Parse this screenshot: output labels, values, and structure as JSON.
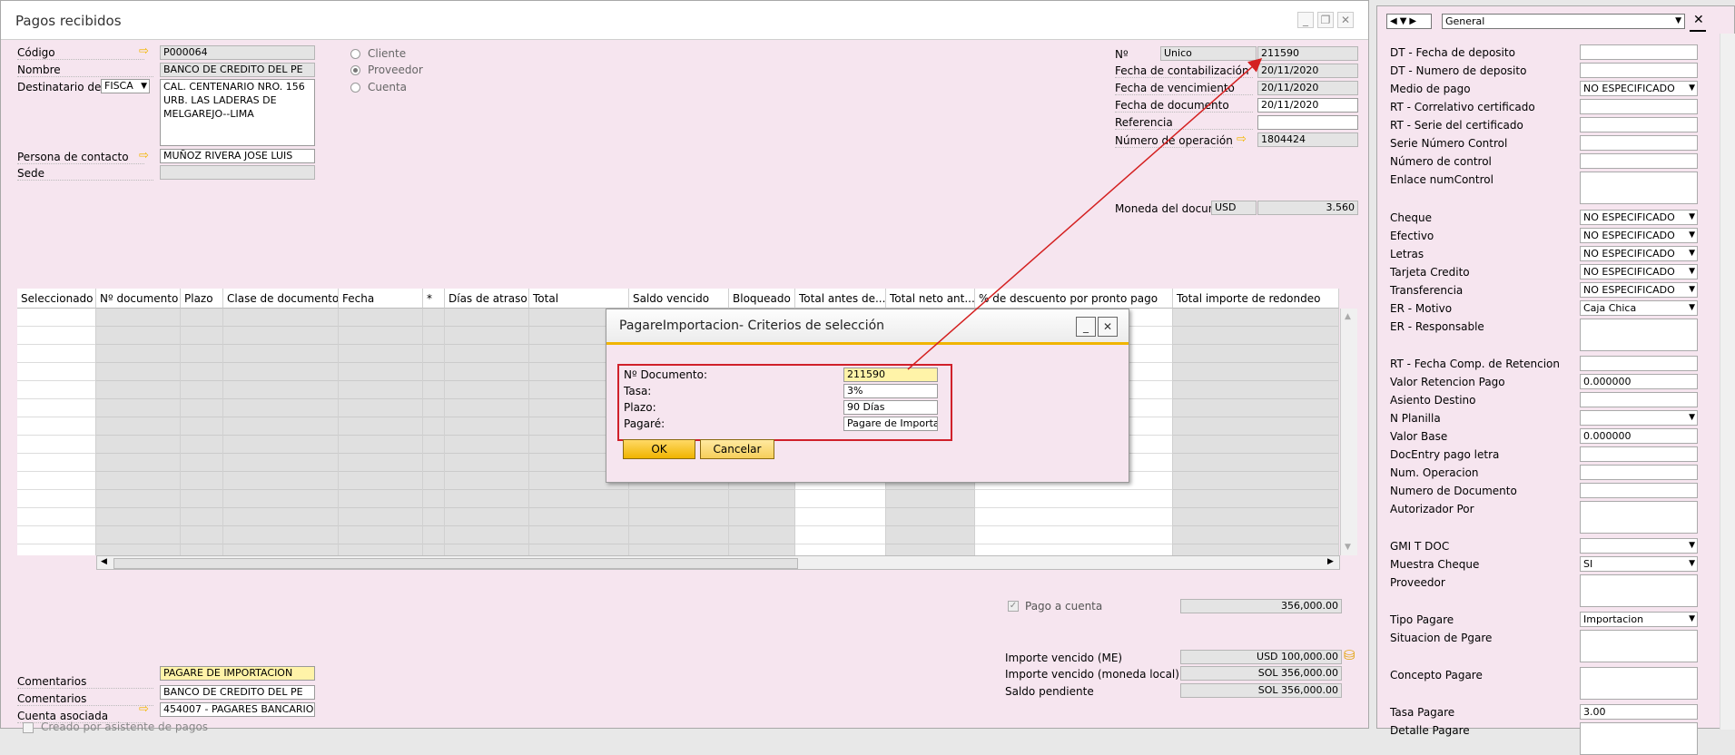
{
  "main": {
    "title": "Pagos recibidos",
    "header_left": {
      "codigo_label": "Código",
      "codigo_value": "P000064",
      "nombre_label": "Nombre",
      "nombre_value": "BANCO DE CREDITO DEL PE",
      "destinatario_label": "Destinatario de f",
      "destinatario_select": "FISCA",
      "address_line1": "CAL. CENTENARIO NRO. 156",
      "address_line2": "URB. LAS LADERAS DE",
      "address_line3": "MELGAREJO--LIMA",
      "contacto_label": "Persona de contacto",
      "contacto_value": "MUÑOZ RIVERA JOSE LUIS",
      "sede_label": "Sede",
      "sede_value": ""
    },
    "radios": {
      "cliente": "Cliente",
      "proveedor": "Proveedor",
      "cuenta": "Cuenta",
      "selected": "proveedor"
    },
    "header_right": {
      "no_label": "Nº",
      "no_series": "Unico",
      "no_value": "211590",
      "fecha_contab_label": "Fecha de contabilización",
      "fecha_contab_value": "20/11/2020",
      "fecha_venc_label": "Fecha de vencimiento",
      "fecha_venc_value": "20/11/2020",
      "fecha_doc_label": "Fecha de documento",
      "fecha_doc_value": "20/11/2020",
      "referencia_label": "Referencia",
      "referencia_value": "",
      "num_operacion_label": "Número de operación",
      "num_operacion_value": "1804424",
      "moneda_label": "Moneda del docum",
      "moneda_value": "USD",
      "tipo_cambio": "3.560"
    },
    "grid_headers": [
      "Seleccionado",
      "Nº documento",
      "Plazo",
      "Clase de documento",
      "Fecha",
      "*",
      "Días de atraso",
      "Total",
      "Saldo vencido",
      "Bloqueado",
      "Total antes de...",
      "Total neto ant...",
      "% de descuento por pronto pago",
      "Total importe de redondeo"
    ],
    "footer": {
      "pago_cuenta_label": "Pago a cuenta",
      "pago_cuenta_value": "356,000.00",
      "importe_me_label": "Importe vencido (ME)",
      "importe_me_value": "USD 100,000.00",
      "importe_ml_label": "Importe vencido (moneda local)",
      "importe_ml_value": "SOL 356,000.00",
      "saldo_label": "Saldo pendiente",
      "saldo_value": "SOL 356,000.00",
      "comentarios1_label": "Comentarios",
      "comentarios1_value": "PAGARE DE IMPORTACION",
      "comentarios2_label": "Comentarios",
      "comentarios2_value": "BANCO DE CREDITO DEL PE",
      "cuenta_label": "Cuenta asociada",
      "cuenta_value": "454007 - PAGARES BANCARIO",
      "creado_label": "Creado por asistente de pagos"
    }
  },
  "dialog": {
    "title": "PagareImportacion- Criterios de selección",
    "fields": [
      {
        "label": "Nº Documento:",
        "value": "211590"
      },
      {
        "label": "Tasa:",
        "value": "3%"
      },
      {
        "label": "Plazo:",
        "value": "90 Días"
      },
      {
        "label": "Pagaré:",
        "value": "Pagare de Importa"
      }
    ],
    "ok_label": "OK",
    "cancel_label": "Cancelar"
  },
  "right_panel": {
    "category": "General",
    "rows": [
      {
        "label": "DT - Fecha de deposito",
        "value": "",
        "dd": false
      },
      {
        "label": "DT - Numero de deposito",
        "value": "",
        "dd": false
      },
      {
        "label": "Medio de pago",
        "value": "NO ESPECIFICADO",
        "dd": true
      },
      {
        "label": "RT - Correlativo certificado",
        "value": "",
        "dd": false
      },
      {
        "label": "RT - Serie del certificado",
        "value": "",
        "dd": false
      },
      {
        "label": "Serie Número Control",
        "value": "",
        "dd": false
      },
      {
        "label": "Número de control",
        "value": "",
        "dd": false
      },
      {
        "label": "Enlace numControl",
        "value": "",
        "dd": false
      },
      {
        "label": "Cheque",
        "value": "NO ESPECIFICADO",
        "dd": true
      },
      {
        "label": "Efectivo",
        "value": "NO ESPECIFICADO",
        "dd": true
      },
      {
        "label": "Letras",
        "value": "NO ESPECIFICADO",
        "dd": true
      },
      {
        "label": "Tarjeta Credito",
        "value": "NO ESPECIFICADO",
        "dd": true
      },
      {
        "label": "Transferencia",
        "value": "NO ESPECIFICADO",
        "dd": true
      },
      {
        "label": "ER - Motivo",
        "value": "Caja Chica",
        "dd": true
      },
      {
        "label": "ER - Responsable",
        "value": "",
        "dd": false
      },
      {
        "label": "RT - Fecha Comp. de Retencion",
        "value": "",
        "dd": false
      },
      {
        "label": "Valor Retencion Pago",
        "value": "0.000000",
        "dd": false
      },
      {
        "label": "Asiento Destino",
        "value": "",
        "dd": false
      },
      {
        "label": "N Planilla",
        "value": "",
        "dd": true
      },
      {
        "label": "Valor Base",
        "value": "0.000000",
        "dd": false
      },
      {
        "label": "DocEntry pago letra",
        "value": "",
        "dd": false
      },
      {
        "label": "Num. Operacion",
        "value": "",
        "dd": false
      },
      {
        "label": "Numero de Documento",
        "value": "",
        "dd": false
      },
      {
        "label": "Autorizador Por",
        "value": "",
        "dd": false
      },
      {
        "label": "GMI  T  DOC",
        "value": "",
        "dd": true
      },
      {
        "label": "Muestra Cheque",
        "value": "SI",
        "dd": true
      },
      {
        "label": "Proveedor",
        "value": "",
        "dd": false
      },
      {
        "label": "Tipo Pagare",
        "value": "Importacion",
        "dd": true
      },
      {
        "label": "Situacion de Pgare",
        "value": "",
        "dd": false
      },
      {
        "label": "Concepto Pagare",
        "value": "",
        "dd": false
      },
      {
        "label": "Tasa Pagare",
        "value": "3.00",
        "dd": false
      },
      {
        "label": "Detalle Pagare",
        "value": "",
        "dd": false
      }
    ]
  },
  "colors": {
    "form_bg": "#f6e5ef",
    "accent": "#f0b400",
    "highlight_box": "#d0202a",
    "arrow_line": "#d42020"
  }
}
